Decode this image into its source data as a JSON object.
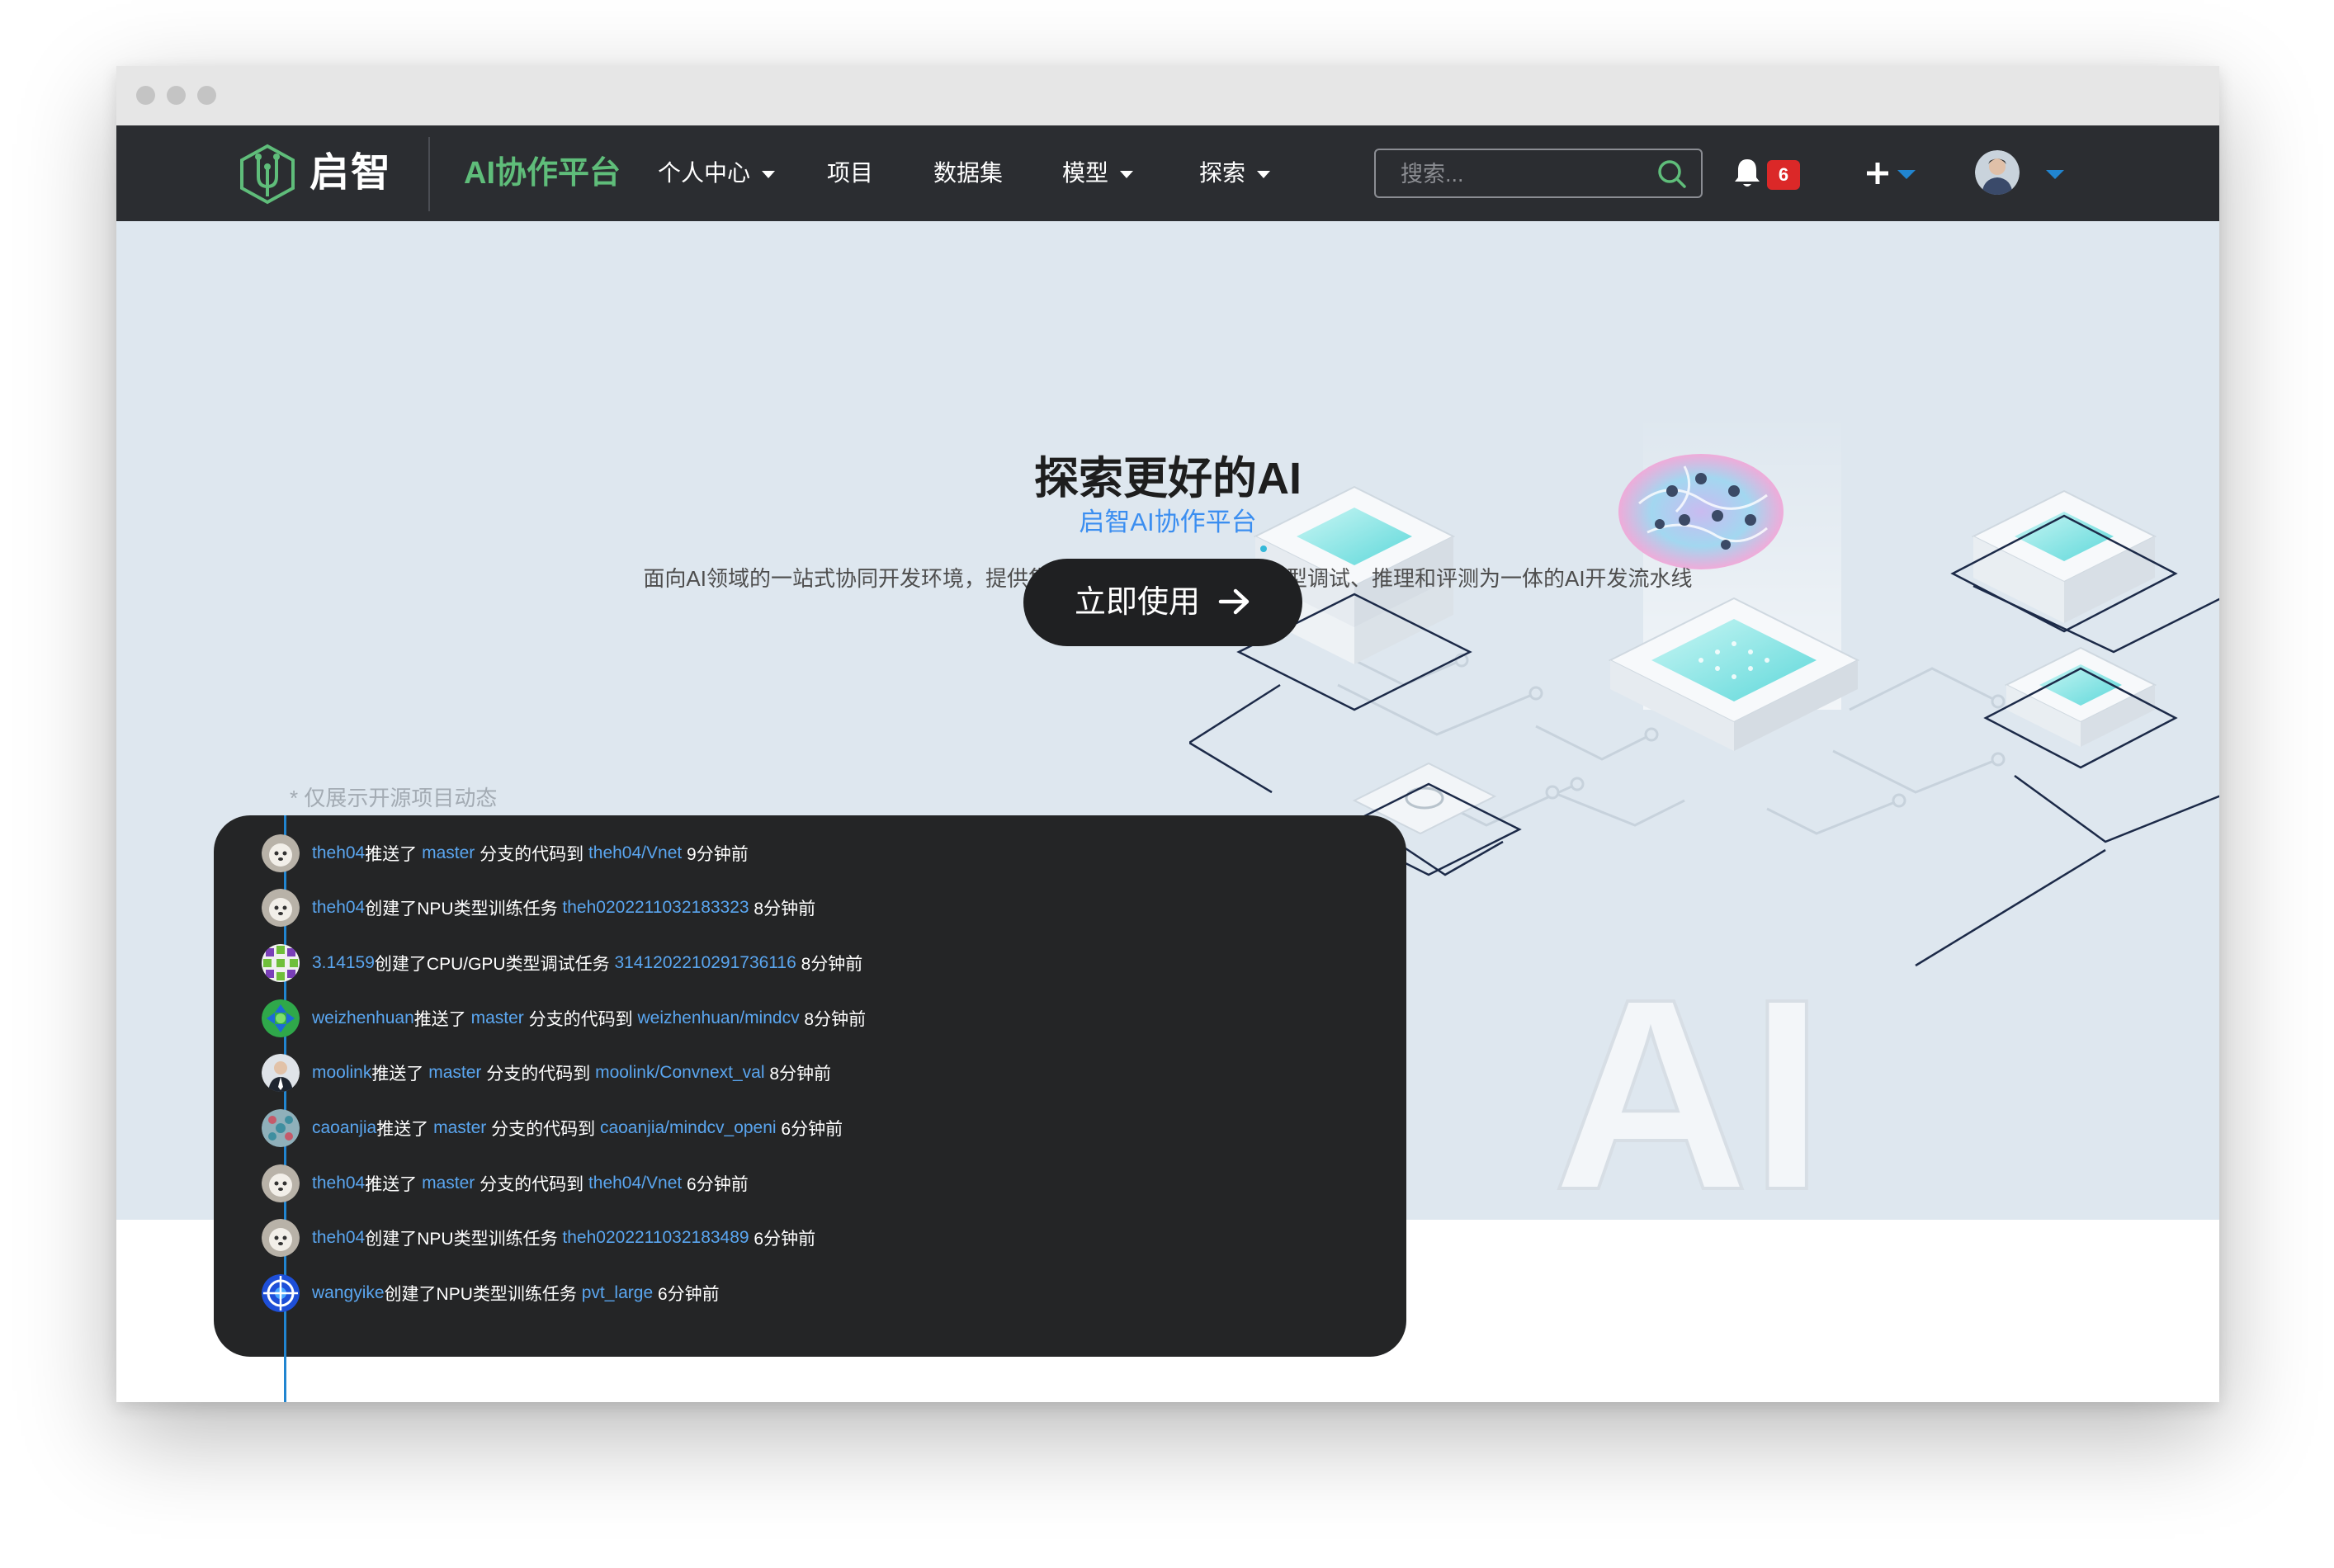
{
  "nav": {
    "logo_text": "启智",
    "brand_name": "AI协作平台",
    "items": [
      {
        "label": "个人中心",
        "has_dropdown": true
      },
      {
        "label": "项目",
        "has_dropdown": false
      },
      {
        "label": "数据集",
        "has_dropdown": false
      },
      {
        "label": "模型",
        "has_dropdown": true
      },
      {
        "label": "探索",
        "has_dropdown": true
      }
    ],
    "search_placeholder": "搜索...",
    "notification_count": "6"
  },
  "hero": {
    "title": "探索更好的AI",
    "subtitle": "启智AI协作平台",
    "description": "面向AI领域的一站式协同开发环境，提供集代码开发、数据管理、模型调试、推理和评测为一体的AI开发流水线",
    "cta_label": "立即使用",
    "illustration_text": "AI"
  },
  "feed": {
    "note": "* 仅展示开源项目动态",
    "items": [
      {
        "user": "theh04",
        "action": "推送了 ",
        "branch": "master",
        "mid": " 分支的代码到 ",
        "target": "theh04/Vnet",
        "time": " 9分钟前",
        "avatar": "dog"
      },
      {
        "user": "theh04",
        "action": "创建了NPU类型训练任务 ",
        "branch": "",
        "mid": "",
        "target": "theh0202211032183323",
        "time": " 8分钟前",
        "avatar": "dog"
      },
      {
        "user": "3.14159",
        "action": "创建了CPU/GPU类型调试任务 ",
        "branch": "",
        "mid": "",
        "target": "3141202210291736116",
        "time": " 8分钟前",
        "avatar": "pattern-purple"
      },
      {
        "user": "weizhenhuan",
        "action": "推送了 ",
        "branch": "master",
        "mid": " 分支的代码到 ",
        "target": "weizhenhuan/mindcv",
        "time": " 8分钟前",
        "avatar": "pattern-green"
      },
      {
        "user": "moolink",
        "action": "推送了 ",
        "branch": "master",
        "mid": " 分支的代码到 ",
        "target": "moolink/Convnext_val",
        "time": " 8分钟前",
        "avatar": "person"
      },
      {
        "user": "caoanjia",
        "action": "推送了 ",
        "branch": "master",
        "mid": " 分支的代码到 ",
        "target": "caoanjia/mindcv_openi",
        "time": " 6分钟前",
        "avatar": "pattern-teal"
      },
      {
        "user": "theh04",
        "action": "推送了 ",
        "branch": "master",
        "mid": " 分支的代码到 ",
        "target": "theh04/Vnet",
        "time": " 6分钟前",
        "avatar": "dog"
      },
      {
        "user": "theh04",
        "action": "创建了NPU类型训练任务 ",
        "branch": "",
        "mid": "",
        "target": "theh0202211032183489",
        "time": " 6分钟前",
        "avatar": "dog"
      },
      {
        "user": "wangyike",
        "action": "创建了NPU类型训练任务 ",
        "branch": "",
        "mid": "",
        "target": "pvt_large",
        "time": " 6分钟前",
        "avatar": "pattern-blue"
      }
    ]
  },
  "colors": {
    "navbar": "#2b2d31",
    "brand_green": "#5fbd7a",
    "link_blue": "#5aa6f0",
    "accent_blue": "#2185d0",
    "hero_bg": "#dee7ef",
    "badge_red": "#db2828"
  }
}
